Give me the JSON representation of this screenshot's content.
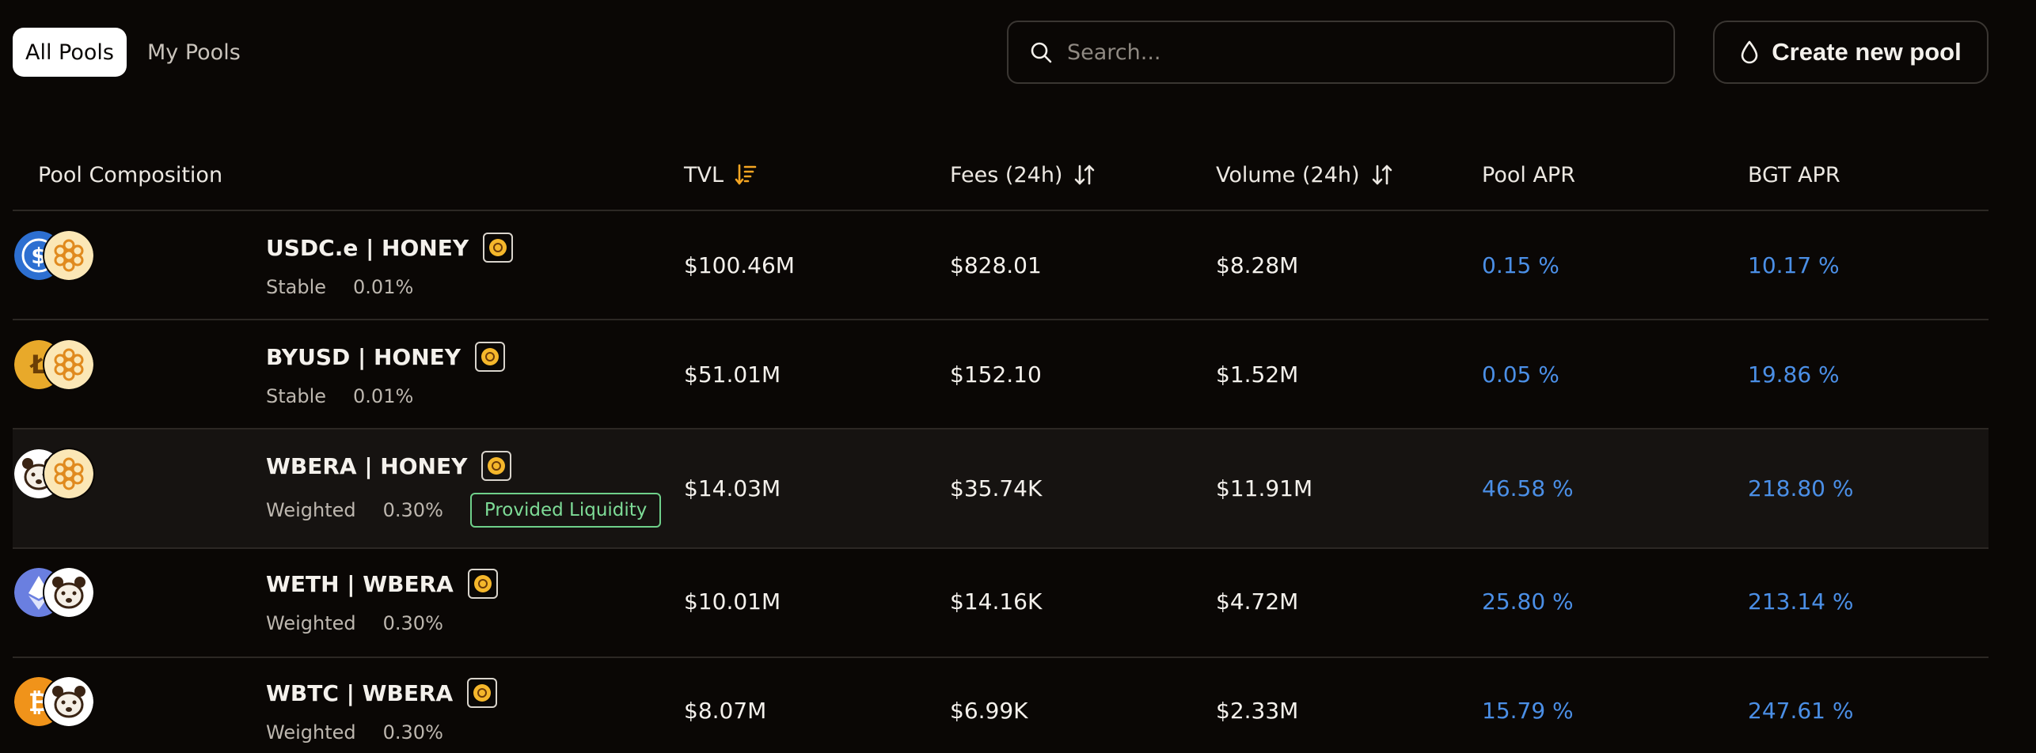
{
  "tabs": [
    {
      "label": "All Pools",
      "active": true
    },
    {
      "label": "My Pools",
      "active": false
    }
  ],
  "search": {
    "placeholder": "Search...",
    "value": ""
  },
  "create_button": {
    "label": "Create new pool"
  },
  "columns": {
    "composition": "Pool Composition",
    "tvl": "TVL",
    "fees": "Fees (24h)",
    "volume": "Volume (24h)",
    "pool_apr": "Pool APR",
    "bgt_apr": "BGT APR"
  },
  "colors": {
    "background": "#0a0705",
    "apr_blue": "#4b8fe6",
    "sort_active": "#f5a623",
    "liquidity_green": "#7edc97"
  },
  "pools": [
    {
      "pair": "USDC.e | HONEY",
      "type": "Stable",
      "fee": "0.01%",
      "tvl": "$100.46M",
      "fees": "$828.01",
      "volume": "$8.28M",
      "pool_apr": "0.15 %",
      "bgt_apr": "10.17 %",
      "tokens": [
        "usdc-icon",
        "honey-icon"
      ],
      "provided_liquidity": ""
    },
    {
      "pair": "BYUSD | HONEY",
      "type": "Stable",
      "fee": "0.01%",
      "tvl": "$51.01M",
      "fees": "$152.10",
      "volume": "$1.52M",
      "pool_apr": "0.05 %",
      "bgt_apr": "19.86 %",
      "tokens": [
        "byusd-icon",
        "honey-icon"
      ],
      "provided_liquidity": ""
    },
    {
      "pair": "WBERA | HONEY",
      "type": "Weighted",
      "fee": "0.30%",
      "tvl": "$14.03M",
      "fees": "$35.74K",
      "volume": "$11.91M",
      "pool_apr": "46.58 %",
      "bgt_apr": "218.80 %",
      "tokens": [
        "bera-icon",
        "honey-icon"
      ],
      "provided_liquidity": "Provided Liquidity"
    },
    {
      "pair": "WETH | WBERA",
      "type": "Weighted",
      "fee": "0.30%",
      "tvl": "$10.01M",
      "fees": "$14.16K",
      "volume": "$4.72M",
      "pool_apr": "25.80 %",
      "bgt_apr": "213.14 %",
      "tokens": [
        "eth-icon",
        "bera-icon"
      ],
      "provided_liquidity": ""
    },
    {
      "pair": "WBTC | WBERA",
      "type": "Weighted",
      "fee": "0.30%",
      "tvl": "$8.07M",
      "fees": "$6.99K",
      "volume": "$2.33M",
      "pool_apr": "15.79 %",
      "bgt_apr": "247.61 %",
      "tokens": [
        "btc-icon",
        "bera-icon"
      ],
      "provided_liquidity": ""
    }
  ]
}
